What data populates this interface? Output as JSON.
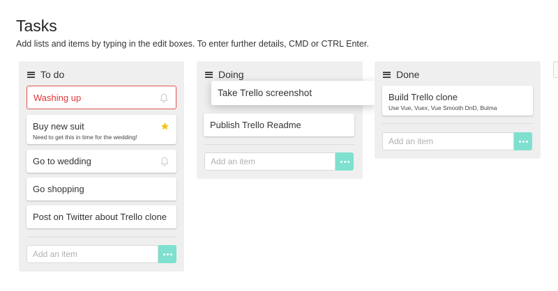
{
  "page": {
    "title": "Tasks",
    "subtitle": "Add lists and items by typing in the edit boxes. To enter further details, CMD or CTRL Enter."
  },
  "lists": [
    {
      "title": "To do",
      "cards": [
        {
          "title": "Washing up",
          "state": "editing",
          "icon": "bell-icon"
        },
        {
          "title": "Buy new suit",
          "description": "Need to get this in time for the wedding!",
          "icon": "star-icon"
        },
        {
          "title": "Go to wedding",
          "icon": "bell-icon"
        },
        {
          "title": "Go shopping"
        },
        {
          "title": "Post on Twitter about Trello clone"
        }
      ],
      "add_placeholder": "Add an item"
    },
    {
      "title": "Doing",
      "cards": [
        {
          "title": "Take Trello screenshot",
          "state": "dragging"
        },
        {
          "title": "Publish Trello Readme"
        }
      ],
      "add_placeholder": "Add an item"
    },
    {
      "title": "Done",
      "cards": [
        {
          "title": "Build Trello clone",
          "description": "Use Vue, Vuex, Vue Smooth DnD, Bulma"
        }
      ],
      "add_placeholder": "Add an item"
    }
  ],
  "colors": {
    "accent": "#7fe0cf",
    "editing_border": "#e05252",
    "editing_text": "#e43535",
    "star": "#f5c518",
    "list_background": "#efefef"
  }
}
